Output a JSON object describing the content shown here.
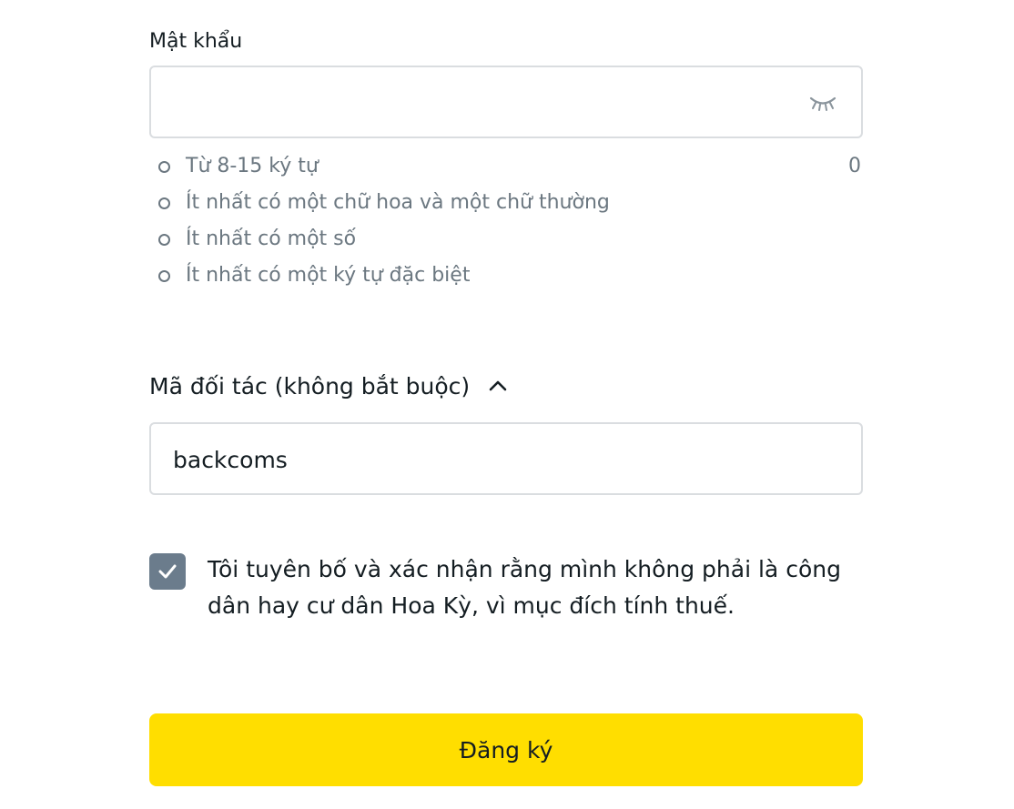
{
  "password": {
    "label": "Mật khẩu",
    "value": "",
    "toggle_icon": "eye-closed-icon",
    "char_count": "0",
    "rules": [
      {
        "text": "Từ 8-15 ký tự"
      },
      {
        "text": "Ít nhất có một chữ hoa và một chữ thường"
      },
      {
        "text": "Ít nhất có một số"
      },
      {
        "text": "Ít nhất có một ký tự đặc biệt"
      }
    ]
  },
  "partner_code": {
    "label": "Mã đối tác (không bắt buộc)",
    "toggle_icon": "chevron-up-icon",
    "expanded": true,
    "value": "backcoms"
  },
  "declaration": {
    "checked": true,
    "text": "Tôi tuyên bố và xác nhận rằng mình không phải là công dân hay cư dân Hoa Kỳ, vì mục đích tính thuế."
  },
  "submit": {
    "label": "Đăng ký"
  },
  "colors": {
    "accent": "#ffde00",
    "checkbox": "#6b7c8c",
    "hint_text": "#6b7780",
    "border": "#dadde0",
    "text": "#141d22"
  }
}
